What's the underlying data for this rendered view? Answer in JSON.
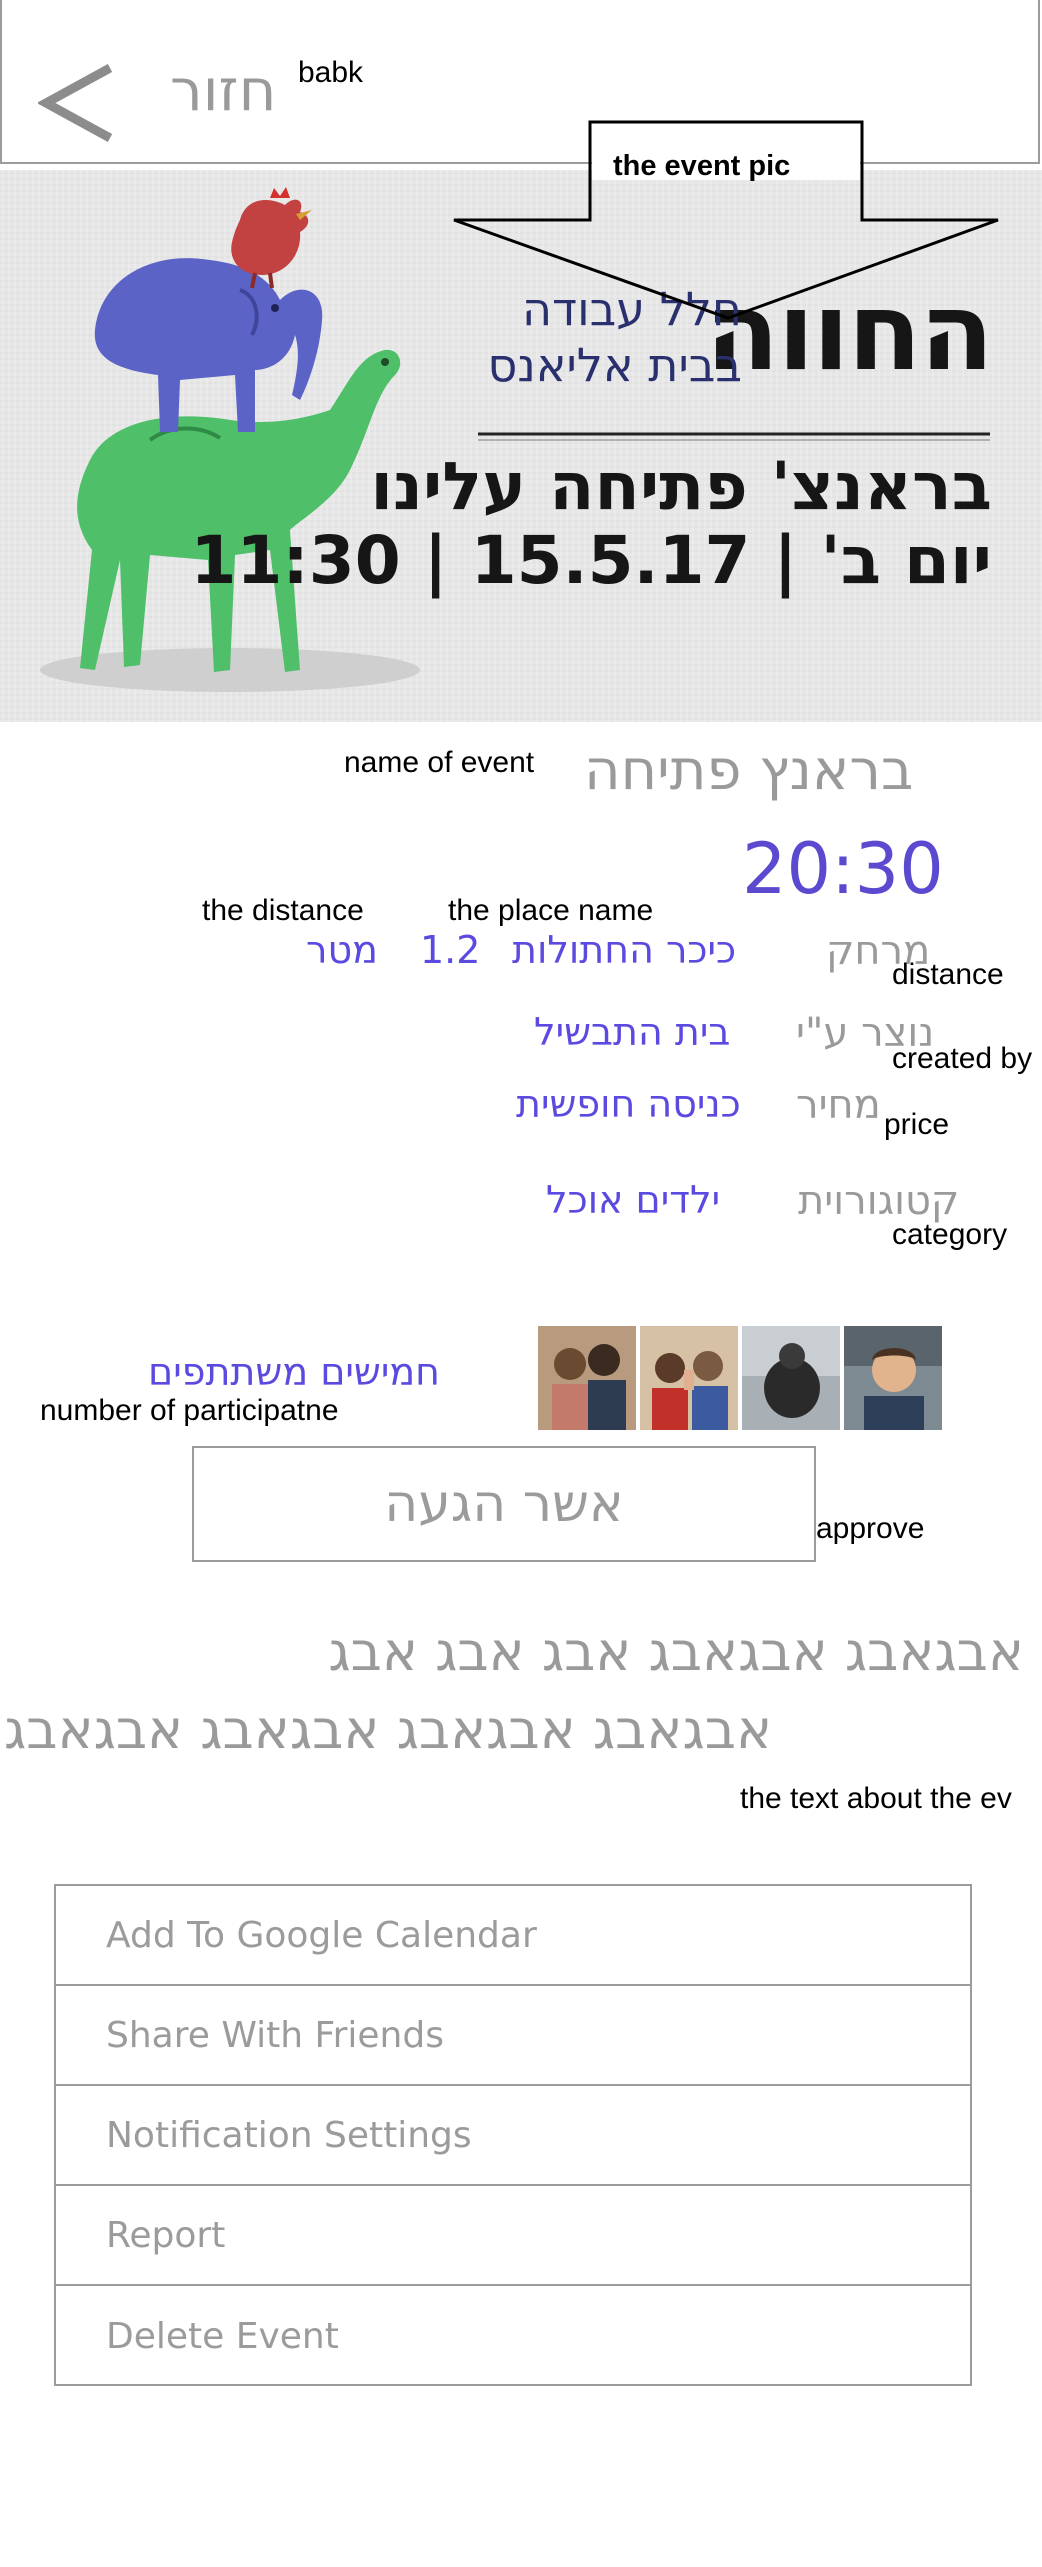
{
  "header": {
    "back_label": "חזור",
    "back_annotation": "babk"
  },
  "event_pic": {
    "annotation": "the event pic",
    "poster": {
      "title": "החווה",
      "subtitle_line1": "חלל עבודה",
      "subtitle_line2": "בבית אליאנס",
      "headline": "בראנצ' פתיחה עלינו",
      "date_line": "יום ב' | 15.5.17 | 11:30"
    }
  },
  "event": {
    "name": "בראנץ פתיחה",
    "name_annotation": "name of event",
    "time": "20:30",
    "distance_label": "מרחק",
    "distance_place": "כיכר החתולות",
    "distance_value": "1.2",
    "distance_unit": "מטר",
    "distance_annotation": "distance",
    "the_distance_annotation": "the distance",
    "place_name_annotation": "the place name",
    "created_by_label": "נוצר ע\"י",
    "created_by_value": "בית התבשיל",
    "created_by_annotation": "created by",
    "price_label": "מחיר",
    "price_value": "כניסה חופשית",
    "price_annotation": "price",
    "category_label": "קטוגורוית",
    "category_value": "ילדים אוכל",
    "category_annotation": "category",
    "participants_text": "חמישים משתתפים",
    "participants_annotation": "number of participatne",
    "approve_label": "אשר הגעה",
    "approve_annotation": "approve",
    "description_line1": "אבגאבג אבגאבג אבג אבג אבג",
    "description_line2": "אבגאבג אבגאבג אבגאבג אבגאבג",
    "description_annotation": "the text about the ev"
  },
  "menu": {
    "items": [
      {
        "label": "Add To Google Calendar"
      },
      {
        "label": "Share With Friends"
      },
      {
        "label": "Notification Settings"
      },
      {
        "label": "Report"
      },
      {
        "label": "Delete Event"
      }
    ]
  },
  "colors": {
    "gray_text": "#9a9a9a",
    "blue_text": "#5b4ae0",
    "border": "#9b9b9b"
  }
}
